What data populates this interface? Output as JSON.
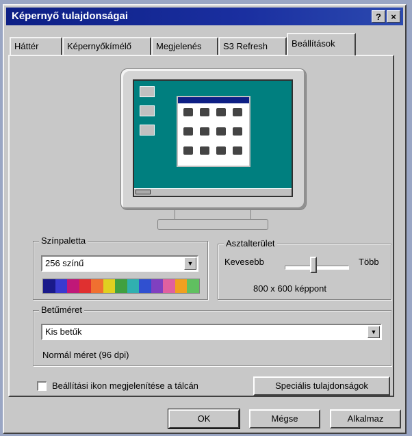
{
  "window": {
    "title": "Képernyő tulajdonságai",
    "help_label": "?",
    "close_label": "×"
  },
  "tabs": [
    {
      "label": "Háttér"
    },
    {
      "label": "Képernyőkímélő"
    },
    {
      "label": "Megjelenés"
    },
    {
      "label": "S3 Refresh"
    },
    {
      "label": "Beállítások",
      "active": true
    }
  ],
  "color_palette": {
    "legend": "Színpaletta",
    "selected": "256 színű",
    "swatch_colors": [
      "#1a1a8a",
      "#3a3ad0",
      "#c01878",
      "#e03030",
      "#f07030",
      "#e0d020",
      "#40a040",
      "#30b0b0",
      "#3050d0",
      "#8040c0",
      "#e060a0",
      "#f0a020",
      "#60c060"
    ]
  },
  "desktop_area": {
    "legend": "Asztalterület",
    "less_label": "Kevesebb",
    "more_label": "Több",
    "resolution": "800 x 600 képpont",
    "slider_position": 0.45
  },
  "font_size": {
    "legend": "Betűméret",
    "selected": "Kis betűk",
    "description": "Normál méret (96 dpi)"
  },
  "taskbar_icon": {
    "label": "Beállítási ikon megjelenítése a tálcán",
    "checked": false
  },
  "buttons": {
    "advanced": "Speciális tulajdonságok",
    "ok": "OK",
    "cancel": "Mégse",
    "apply": "Alkalmaz"
  }
}
